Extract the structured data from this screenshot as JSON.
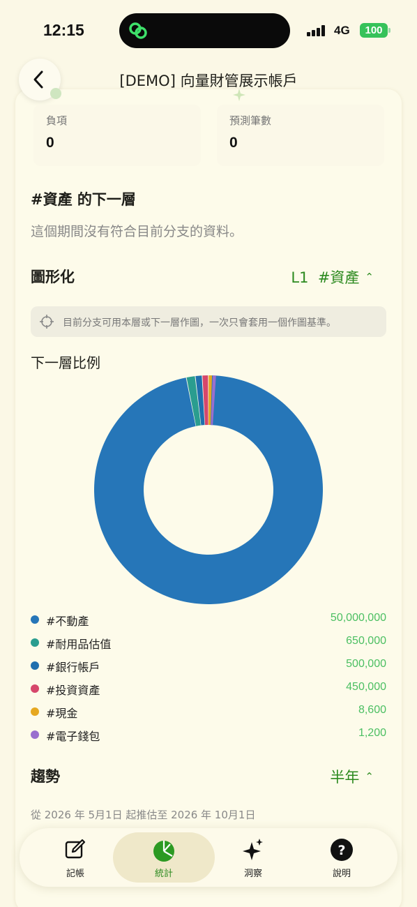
{
  "status": {
    "time": "12:15",
    "network": "4G",
    "battery": "100"
  },
  "nav": {
    "title": "[DEMO] 向量財管展示帳戶",
    "back_icon": "chevron-left-icon"
  },
  "stats": [
    {
      "label": "負項",
      "value": "0"
    },
    {
      "label": "預測筆數",
      "value": "0"
    }
  ],
  "next_layer": {
    "title": "#資產 的下一層",
    "empty": "這個期間沒有符合目前分支的資料。"
  },
  "chart_section": {
    "title": "圖形化",
    "selector": "L1  #資產",
    "hint": "目前分支可用本層或下一層作圖，一次只會套用一個作圖基準。",
    "ratio_title": "下一層比例"
  },
  "chart_data": {
    "type": "pie",
    "categories": [
      "#不動產",
      "#耐用品估值",
      "#銀行帳戶",
      "#投資資產",
      "#現金",
      "#電子錢包"
    ],
    "values": [
      50000000,
      650000,
      500000,
      450000,
      8600,
      1200
    ],
    "display_values": [
      "50,000,000",
      "650,000",
      "500,000",
      "450,000",
      "8,600",
      "1,200"
    ],
    "colors": [
      "#2676b8",
      "#2a9d8f",
      "#1f6fae",
      "#d6476b",
      "#e6a820",
      "#9a6fce"
    ],
    "donut": true
  },
  "trend": {
    "title": "趨勢",
    "selector": "半年",
    "range": "從 2026 年 5月1日 起推估至 2026 年 10月1日"
  },
  "tabs": [
    {
      "label": "記帳",
      "icon": "edit-icon"
    },
    {
      "label": "統計",
      "icon": "pie-chart-icon",
      "active": true
    },
    {
      "label": "洞察",
      "icon": "sparkle-icon"
    },
    {
      "label": "說明",
      "icon": "help-icon"
    }
  ]
}
